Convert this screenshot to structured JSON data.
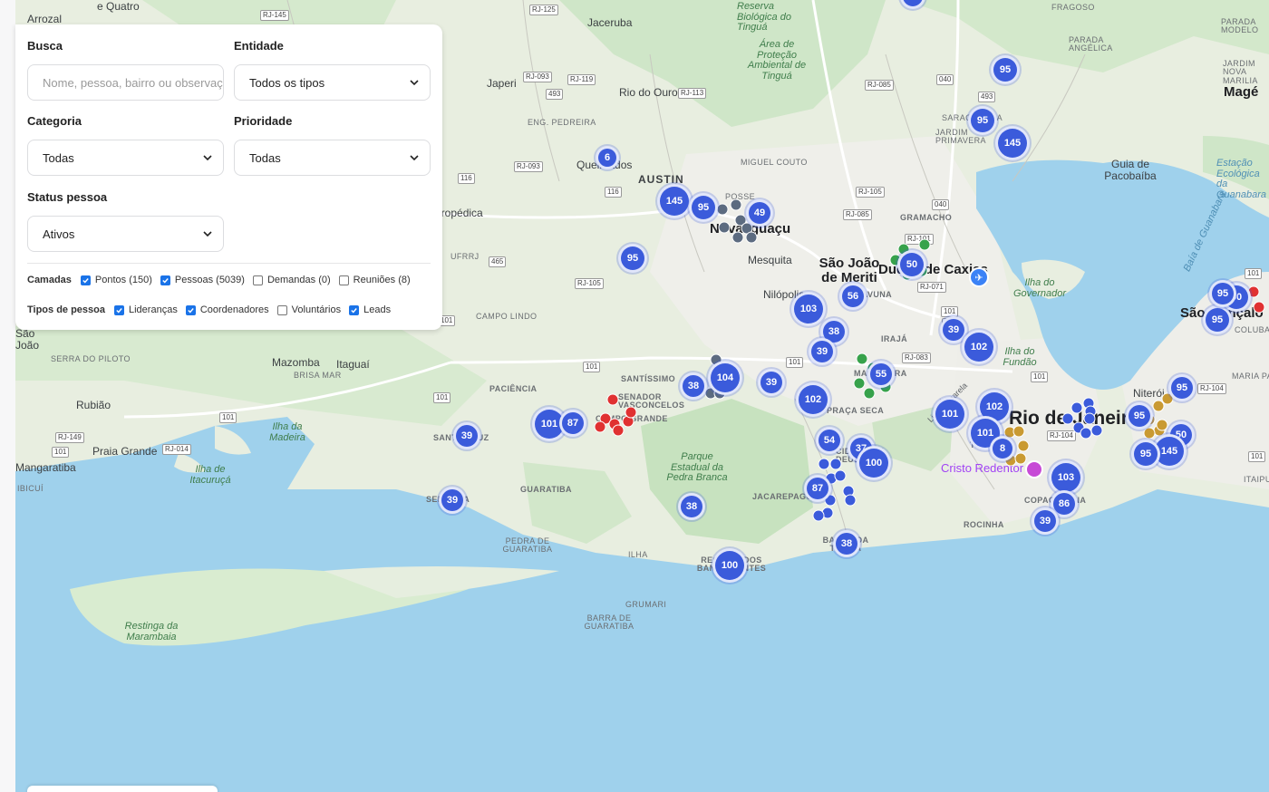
{
  "filters": {
    "busca": {
      "label": "Busca",
      "placeholder": "Nome, pessoa, bairro ou observação"
    },
    "entidade": {
      "label": "Entidade",
      "value": "Todos os tipos"
    },
    "categoria": {
      "label": "Categoria",
      "value": "Todas"
    },
    "prioridade": {
      "label": "Prioridade",
      "value": "Todas"
    },
    "status_pessoa": {
      "label": "Status pessoa",
      "value": "Ativos"
    }
  },
  "camadas": {
    "label": "Camadas",
    "items": [
      {
        "label": "Pontos (150)",
        "checked": true
      },
      {
        "label": "Pessoas (5039)",
        "checked": true
      },
      {
        "label": "Demandas (0)",
        "checked": false
      },
      {
        "label": "Reuniões (8)",
        "checked": false
      }
    ]
  },
  "tipos_pessoa": {
    "label": "Tipos de pessoa",
    "items": [
      {
        "label": "Lideranças",
        "checked": true
      },
      {
        "label": "Coordenadores",
        "checked": true
      },
      {
        "label": "Voluntários",
        "checked": false
      },
      {
        "label": "Leads",
        "checked": true
      }
    ]
  },
  "map": {
    "place_labels": [
      "Arrozal",
      "e Quatro",
      "Reserva Biológica do Tinguá",
      "Jaceruba",
      "FRAGOSO",
      "PARADA ANGÉLICA",
      "JARDIM NOVA MARILIA",
      "Magé",
      "PARADA MODELO",
      "Área de Proteção Ambiental de Tinguá",
      "Japeri",
      "Rio do Ouro",
      "ENG. PEDREIRA",
      "SARACURUNA",
      "JARDIM PRIMAVERA",
      "MIGUEL COUTO",
      "Queimados",
      "Guia de Pacobaíba",
      "Estação Ecológica da Guanabara",
      "AUSTIN",
      "POSSE",
      "Nova Iguaçu",
      "GRAMACHO",
      "Seropédica",
      "Baía de Guanabara",
      "UFRRJ",
      "Mesquita",
      "São João de Meriti",
      "Duque de Caxias",
      "Ilha do Governador",
      "São Gonçalo",
      "COLUBANDÊ",
      "CAMPO LINDO",
      "Nilópolis",
      "PAVUNA",
      "IRAJÁ",
      "Ilha do Fundão",
      "Mazomba",
      "Itaguaí",
      "BRISA MAR",
      "SERRA DO PILOTO",
      "PACIÊNCIA",
      "SANTÍSSIMO",
      "SENADOR VASCONCELOS",
      "CAMPO GRANDE",
      "MADUREIRA",
      "PRAÇA SECA",
      "Linha Amarela",
      "Niterói",
      "MARIA PAULA",
      "Rubião",
      "Ilha da Madeira",
      "SANTA CRUZ",
      "Rio de Janeiro",
      "Praia Grande",
      "Mangaratiba",
      "Ilha de Itacuruçá",
      "IBICUÍ",
      "Parque Estadual da Pedra Branca",
      "CIDADE DE DEUS",
      "TIJUCA",
      "Cristo Redentor",
      "ITAIPU",
      "SEPETIBA",
      "GUARATIBA",
      "JACAREPAGUÁ",
      "COPACABANA",
      "ROCINHA",
      "BARRA DA TIJUCA",
      "PEDRA DE GUARATIBA",
      "ILHA",
      "RECREIO DOS BANDEIRANTES",
      "GRUMARI",
      "Restinga da Marambaia",
      "BARRA DE GUARATIBA",
      "São João"
    ],
    "road_shields": [
      "RJ-145",
      "RJ-125",
      "RJ-093",
      "RJ-119",
      "493",
      "RJ-113",
      "RJ-085",
      "040",
      "493",
      "RJ-093",
      "116",
      "116",
      "RJ-105",
      "RJ-085",
      "040",
      "465",
      "RJ-105",
      "RJ-101",
      "RJ-071",
      "101",
      "101",
      "101",
      "101",
      "RJ-083",
      "101",
      "101",
      "RJ-104",
      "101",
      "101",
      "RJ-149",
      "101",
      "RJ-014",
      "101",
      "RJ-104",
      "101"
    ],
    "clusters": [
      "6",
      "95",
      "145",
      "95",
      "145",
      "95",
      "49",
      "95",
      "56",
      "103",
      "38",
      "39",
      "50",
      "39",
      "102",
      "55",
      "104",
      "38",
      "39",
      "102",
      "101",
      "87",
      "101",
      "39",
      "102",
      "101",
      "54",
      "37",
      "100",
      "87",
      "38",
      "38",
      "100",
      "39",
      "103",
      "86",
      "39",
      "95",
      "95",
      "50",
      "145",
      "95",
      "95",
      "50",
      "95",
      "8"
    ],
    "dot_colors": {
      "liderancas": "#e03131",
      "coordenadores": "#5c6b80",
      "voluntarios": "#37a24b",
      "leads": "#c99a32",
      "pontos": "#3b5bdb"
    }
  }
}
